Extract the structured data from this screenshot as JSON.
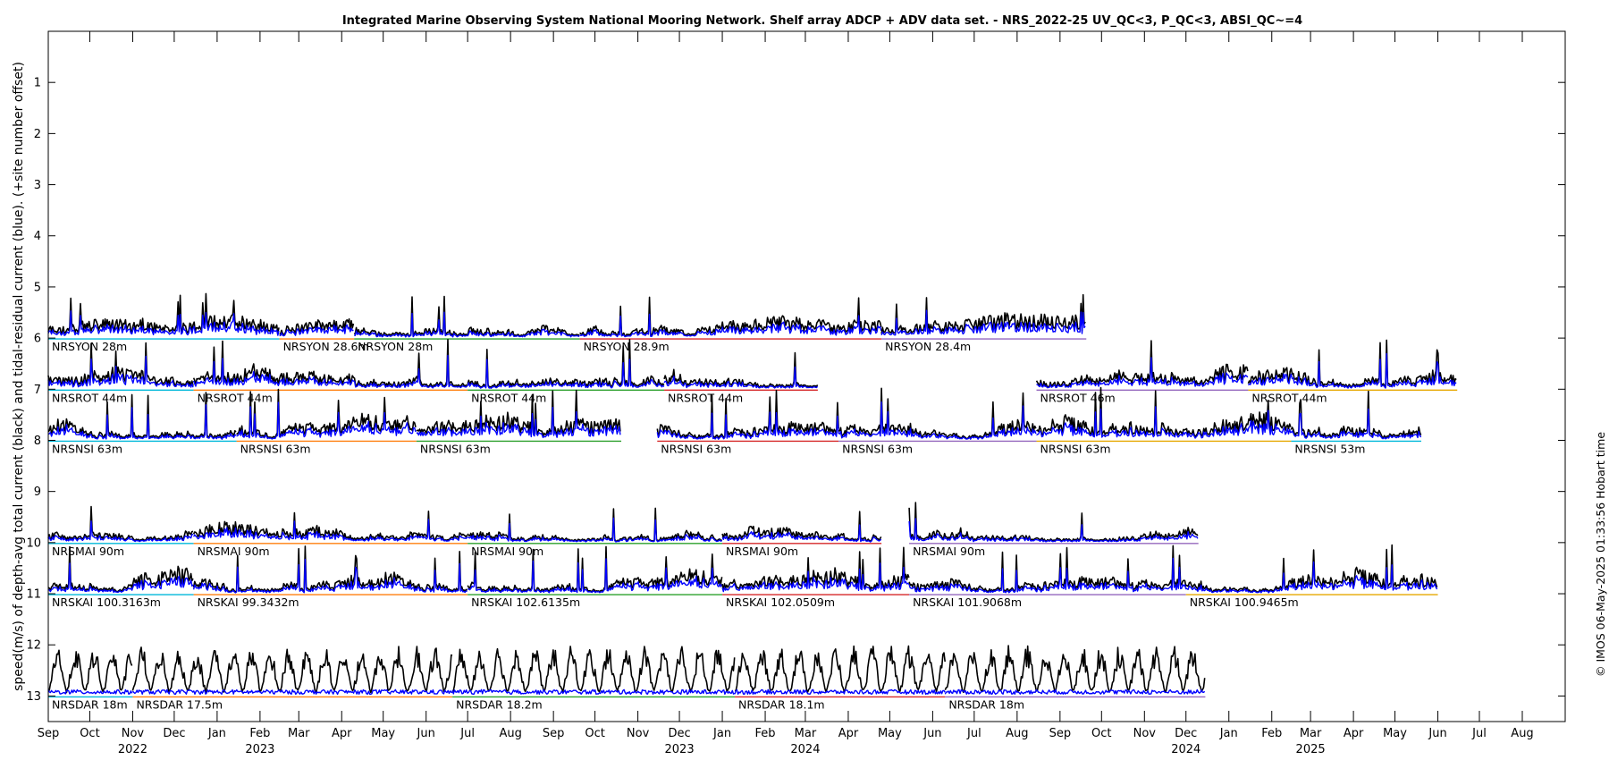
{
  "chart_data": {
    "type": "line",
    "title": "Integrated Marine Observing System National Mooring Network. Shelf array ADCP + ADV data set. - NRS_2022-25 UV_QC<3, P_QC<3, ABSI_QC~=4",
    "ylabel": "speed(m/s) of depth-avg total current (black) and tidal-residual current (blue). (+site number offset)",
    "credit": "© IMOS 06-May-2025 01:33:56 Hobart time",
    "xlim": [
      "2022-09-01",
      "2025-09-01"
    ],
    "ylim": [
      13.5,
      0
    ],
    "y_reversed": true,
    "y_ticks": [
      1,
      2,
      3,
      4,
      5,
      6,
      7,
      8,
      9,
      10,
      11,
      12,
      13
    ],
    "x_month_ticks": [
      "Sep",
      "Oct",
      "Nov",
      "Dec",
      "Jan",
      "Feb",
      "Mar",
      "Apr",
      "May",
      "Jun",
      "Jul",
      "Aug",
      "Sep",
      "Oct",
      "Nov",
      "Dec",
      "Jan",
      "Feb",
      "Mar",
      "Apr",
      "May",
      "Jun",
      "Jul",
      "Aug",
      "Sep",
      "Oct",
      "Nov",
      "Dec",
      "Jan",
      "Feb",
      "Mar",
      "Apr",
      "May",
      "Jun",
      "Jul",
      "Aug"
    ],
    "x_year_ticks": [
      {
        "label": "2022",
        "date": "2022-11-01"
      },
      {
        "label": "2023",
        "date": "2023-02-01"
      },
      {
        "label": "2023",
        "date": "2023-12-01"
      },
      {
        "label": "2024",
        "date": "2024-03-01"
      },
      {
        "label": "2024",
        "date": "2024-12-01"
      },
      {
        "label": "2025",
        "date": "2025-03-01"
      }
    ],
    "series": [
      {
        "name": "Total current",
        "color": "#000000"
      },
      {
        "name": "Tidal-residual current",
        "color": "#0000ff"
      }
    ],
    "sites": [
      {
        "offset": 6,
        "amp": 0.55,
        "type": "noisy",
        "segments": [
          {
            "label": "NRSYON 28m",
            "start": "2022-09-01",
            "end": "2023-02-15"
          },
          {
            "label": "NRSYON 28.6m",
            "start": "2023-02-15",
            "end": "2023-04-10"
          },
          {
            "label": "NRSYON 28m",
            "start": "2023-04-10",
            "end": "2023-09-20"
          },
          {
            "label": "NRSYON 28.9m",
            "start": "2023-09-20",
            "end": "2024-04-25"
          },
          {
            "label": "NRSYON 28.4m",
            "start": "2024-04-25",
            "end": "2024-09-20"
          }
        ]
      },
      {
        "offset": 7,
        "amp": 0.62,
        "type": "noisy",
        "segments": [
          {
            "label": "NRSROT 44m",
            "start": "2022-09-01",
            "end": "2022-12-15"
          },
          {
            "label": "NRSROT 44m",
            "start": "2022-12-15",
            "end": "2023-07-01"
          },
          {
            "label": "NRSROT 44m",
            "start": "2023-07-01",
            "end": "2023-11-20"
          },
          {
            "label": "NRSROT 44m",
            "start": "2023-11-20",
            "end": "2024-03-10"
          },
          {
            "label": "NRSROT 46m",
            "start": "2024-08-15",
            "end": "2025-01-15"
          },
          {
            "label": "NRSROT 44m",
            "start": "2025-01-15",
            "end": "2025-06-15"
          }
        ]
      },
      {
        "offset": 8,
        "amp": 0.65,
        "type": "noisy",
        "segments": [
          {
            "label": "NRSNSI 63m",
            "start": "2022-09-01",
            "end": "2023-01-15"
          },
          {
            "label": "NRSNSI 63m",
            "start": "2023-01-15",
            "end": "2023-05-25"
          },
          {
            "label": "NRSNSI 63m",
            "start": "2023-05-25",
            "end": "2023-10-20"
          },
          {
            "label": "NRSNSI 63m",
            "start": "2023-11-15",
            "end": "2024-03-25"
          },
          {
            "label": "NRSNSI 63m",
            "start": "2024-03-25",
            "end": "2024-08-15"
          },
          {
            "label": "NRSNSI 63m",
            "start": "2024-08-15",
            "end": "2025-02-15"
          },
          {
            "label": "NRSNSI 53m",
            "start": "2025-02-15",
            "end": "2025-05-20"
          }
        ]
      },
      {
        "offset": 10,
        "amp": 0.5,
        "type": "noisy",
        "segments": [
          {
            "label": "NRSMAI 90m",
            "start": "2022-09-01",
            "end": "2022-12-15"
          },
          {
            "label": "NRSMAI 90m",
            "start": "2022-12-15",
            "end": "2023-07-01"
          },
          {
            "label": "NRSMAI 90m",
            "start": "2023-07-01",
            "end": "2024-01-01"
          },
          {
            "label": "NRSMAI 90m",
            "start": "2024-01-01",
            "end": "2024-04-25"
          },
          {
            "label": "NRSMAI 90m",
            "start": "2024-05-15",
            "end": "2024-12-10"
          }
        ]
      },
      {
        "offset": 11,
        "amp": 0.6,
        "type": "noisy",
        "segments": [
          {
            "label": "NRSKAI 100.3163m",
            "start": "2022-09-01",
            "end": "2022-12-15"
          },
          {
            "label": "NRSKAI 99.3432m",
            "start": "2022-12-15",
            "end": "2023-07-01"
          },
          {
            "label": "NRSKAI 102.6135m",
            "start": "2023-07-01",
            "end": "2024-01-01"
          },
          {
            "label": "NRSKAI 102.0509m",
            "start": "2024-01-01",
            "end": "2024-05-15"
          },
          {
            "label": "NRSKAI 101.9068m",
            "start": "2024-05-15",
            "end": "2024-12-01"
          },
          {
            "label": "NRSKAI 100.9465m",
            "start": "2024-12-01",
            "end": "2025-06-01"
          }
        ]
      },
      {
        "offset": 13,
        "amp": 1.0,
        "type": "tidal",
        "segments": [
          {
            "label": "NRSDAR 18m",
            "start": "2022-09-01",
            "end": "2022-11-01"
          },
          {
            "label": "NRSDAR 17.5m",
            "start": "2022-11-01",
            "end": "2023-06-20"
          },
          {
            "label": "NRSDAR 18.2m",
            "start": "2023-06-20",
            "end": "2024-01-10"
          },
          {
            "label": "NRSDAR 18.1m",
            "start": "2024-01-10",
            "end": "2024-06-10"
          },
          {
            "label": "NRSDAR 18m",
            "start": "2024-06-10",
            "end": "2024-12-15"
          }
        ]
      }
    ]
  }
}
